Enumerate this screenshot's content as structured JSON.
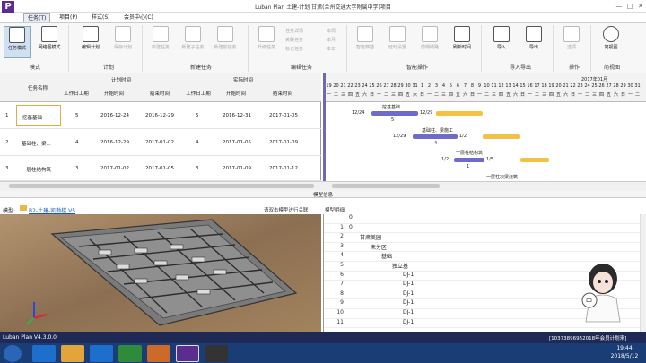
{
  "app": {
    "title": "Luban Plan 土建-计划 甘肃(兰州交通大学附属中学)项目",
    "logo": "P"
  },
  "menus": [
    "任务(T)",
    "项目(P)",
    "样式(S)",
    "会员中心(C)"
  ],
  "ribbon": {
    "buttons": [
      {
        "label": "任务模式",
        "group": 0
      },
      {
        "label": "网络图模式",
        "group": 0
      },
      {
        "label": "编辑计划",
        "group": 1
      },
      {
        "label": "保存计划",
        "group": 1
      },
      {
        "label": "新建任务",
        "group": 2
      },
      {
        "label": "新建子任务",
        "group": 2
      },
      {
        "label": "新建前任务",
        "group": 2
      },
      {
        "label": "升级任务",
        "group": 3
      },
      {
        "label": "智能穿插",
        "group": 4
      },
      {
        "label": "延时设置",
        "group": 4
      },
      {
        "label": "前期线路",
        "group": 4
      },
      {
        "label": "刷新时间",
        "group": 4
      },
      {
        "label": "导入",
        "group": 5
      },
      {
        "label": "导出",
        "group": 5
      },
      {
        "label": "选项",
        "group": 6
      },
      {
        "label": "简视图",
        "group": 7
      }
    ],
    "small_buttons": [
      "任务详情",
      "关联任务",
      "标记任务",
      "本周",
      "本月",
      "本年"
    ],
    "groups": [
      "模式",
      "计划",
      "新建任务",
      "编辑任务",
      "智能操作",
      "导入导出",
      "操作",
      "简视图"
    ]
  },
  "grid": {
    "group_headers": {
      "planned": "计划时间",
      "actual": "实际时间"
    },
    "columns": [
      "任务名称",
      "工作日工期",
      "开始时间",
      "结束时间",
      "工作日工期",
      "开始时间",
      "结束时间"
    ],
    "rows": [
      {
        "idx": "1",
        "name": "挖基基础",
        "dur": "5",
        "start": "2016-12-24",
        "end": "2016-12-29",
        "adur": "5",
        "astart": "2016-12-31",
        "aend": "2017-01-05"
      },
      {
        "idx": "2",
        "name": "基础柱、梁...",
        "dur": "4",
        "start": "2016-12-29",
        "end": "2017-01-02",
        "adur": "4",
        "astart": "2017-01-05",
        "aend": "2017-01-09"
      },
      {
        "idx": "3",
        "name": "一层柱结构筑",
        "dur": "3",
        "start": "2017-01-02",
        "end": "2017-01-05",
        "adur": "3",
        "astart": "2017-01-09",
        "aend": "2017-01-12"
      }
    ]
  },
  "gantt": {
    "month": "2017年01月",
    "days": [
      "19",
      "20",
      "21",
      "22",
      "23",
      "24",
      "25",
      "26",
      "27",
      "28",
      "29",
      "30",
      "31",
      "1",
      "2",
      "3",
      "4",
      "5",
      "6",
      "7",
      "8",
      "9",
      "10",
      "11",
      "12",
      "13",
      "14",
      "15",
      "16",
      "17",
      "18",
      "19",
      "20",
      "21",
      "22",
      "23",
      "24",
      "25",
      "26",
      "27",
      "28",
      "29",
      "30",
      "31"
    ],
    "weekdays": [
      "一",
      "二",
      "三",
      "四",
      "五",
      "六",
      "日",
      "一",
      "二",
      "三",
      "四",
      "五",
      "六",
      "日",
      "一",
      "二",
      "三",
      "四",
      "五",
      "六",
      "日",
      "一",
      "二",
      "三",
      "四",
      "五",
      "六",
      "日",
      "一",
      "二",
      "三",
      "四",
      "五",
      "六",
      "日",
      "一",
      "二",
      "三",
      "四",
      "五",
      "六",
      "日",
      "一",
      "二"
    ],
    "tasks": [
      {
        "label": "挖基基础",
        "start_label": "12/24",
        "end_label": "12/29",
        "duration_label": "5"
      },
      {
        "label": "基础柱、梁施工",
        "start_label": "12/29",
        "end_label": "1/2",
        "duration_label": "4"
      },
      {
        "label": "一层柱结构筑",
        "start_label": "1/2",
        "end_label": "1/5",
        "duration_label": "1"
      },
      {
        "label": "一层柱次梁浇筑"
      }
    ],
    "colors": {
      "plan": "#6f6cc9",
      "actual": "#f2c244",
      "today": "#6a6ab8"
    }
  },
  "panel": {
    "title": "模型信息"
  },
  "model": {
    "label": "模型:",
    "path": "B2-土建-凯勤楼.V5",
    "link": "请双击模型进行关联",
    "info": "模型明细"
  },
  "tree": [
    {
      "n": "",
      "t": "0",
      "indent": 0
    },
    {
      "n": "1",
      "t": "0",
      "indent": 0
    },
    {
      "n": "2",
      "t": "甘肃美园",
      "indent": 1
    },
    {
      "n": "3",
      "t": "未分区",
      "indent": 2
    },
    {
      "n": "4",
      "t": "基础",
      "indent": 3
    },
    {
      "n": "5",
      "t": "独立基",
      "indent": 4
    },
    {
      "n": "6",
      "t": "DJ-1",
      "indent": 5
    },
    {
      "n": "7",
      "t": "DJ-1",
      "indent": 5
    },
    {
      "n": "8",
      "t": "DJ-1",
      "indent": 5
    },
    {
      "n": "9",
      "t": "DJ-1",
      "indent": 5
    },
    {
      "n": "10",
      "t": "DJ-1",
      "indent": 5
    },
    {
      "n": "11",
      "t": "DJ-1",
      "indent": 5
    }
  ],
  "status": {
    "version": "Luban Plan V4.3.0.0",
    "right": "[10373896952018年会员计划来]"
  },
  "taskbar": {
    "time": "19:44",
    "date": "2018/5/12"
  }
}
